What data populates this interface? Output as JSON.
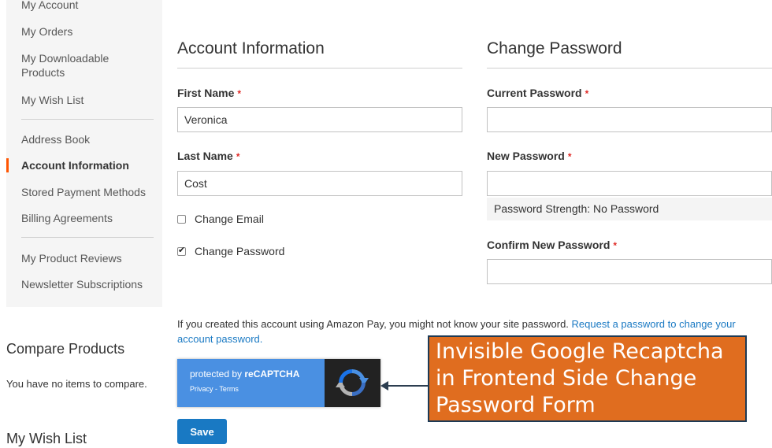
{
  "sidebar": {
    "items": [
      {
        "label": "My Account"
      },
      {
        "label": "My Orders"
      },
      {
        "label": "My Downloadable Products"
      },
      {
        "label": "My Wish List"
      },
      {
        "label": "Address Book"
      },
      {
        "label": "Account Information"
      },
      {
        "label": "Stored Payment Methods"
      },
      {
        "label": "Billing Agreements"
      },
      {
        "label": "My Product Reviews"
      },
      {
        "label": "Newsletter Subscriptions"
      }
    ],
    "current": "Account Information"
  },
  "compare": {
    "title": "Compare Products",
    "empty_text": "You have no items to compare."
  },
  "wishlist_block": {
    "title": "My Wish List"
  },
  "account_info": {
    "title": "Account Information",
    "first_name_label": "First Name",
    "first_name_value": "Veronica",
    "last_name_label": "Last Name",
    "last_name_value": "Cost",
    "change_email_label": "Change Email",
    "change_email_checked": false,
    "change_password_label": "Change Password",
    "change_password_checked": true,
    "required_mark": "*"
  },
  "change_password": {
    "title": "Change Password",
    "current_label": "Current Password",
    "new_label": "New Password",
    "strength_text": "Password Strength: No Password",
    "confirm_label": "Confirm New Password"
  },
  "amazon": {
    "text": "If you created this account using Amazon Pay, you might not know your site password. ",
    "link": "Request a password to change your account password."
  },
  "recaptcha": {
    "protected_by": "protected by ",
    "brand": "reCAPTCHA",
    "privacy": "Privacy",
    "separator": " - ",
    "terms": "Terms"
  },
  "callout": {
    "text": "Invisible Google Recaptcha in Frontend Side Change Password Form"
  },
  "actions": {
    "save_label": "Save"
  },
  "colors": {
    "accent": "#ff5501",
    "primary": "#1979c3",
    "required": "#e02b27",
    "recaptcha_blue": "#4a90e2",
    "callout_orange": "#e06d1f"
  }
}
